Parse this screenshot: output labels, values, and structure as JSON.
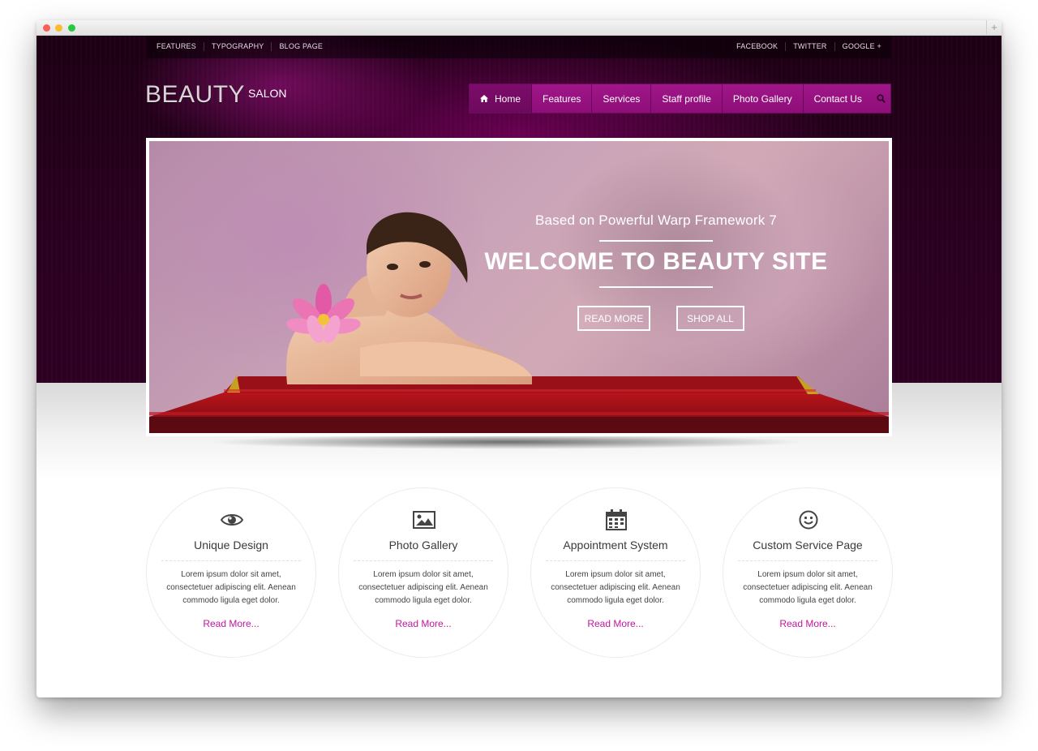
{
  "top_links_left": [
    "FEATURES",
    "TYPOGRAPHY",
    "BLOG PAGE"
  ],
  "top_links_right": [
    "FACEBOOK",
    "TWITTER",
    "GOOGLE +"
  ],
  "logo": {
    "main": "BEAUTY",
    "sub": "SALON"
  },
  "nav": {
    "items": [
      "Home",
      "Features",
      "Services",
      "Staff profile",
      "Photo Gallery",
      "Contact Us"
    ],
    "active": "Home",
    "home_icon": "home-icon",
    "search_icon": "search-icon"
  },
  "hero": {
    "subtitle": "Based on Powerful Warp Framework 7",
    "title": "WELCOME TO BEAUTY SITE",
    "read_more": "READ MORE",
    "shop_all": "SHOP ALL"
  },
  "features": [
    {
      "icon": "eye-icon",
      "title": "Unique Design",
      "text": "Lorem ipsum dolor sit amet, consectetuer adipiscing elit. Aenean commodo ligula eget dolor.",
      "link": "Read More..."
    },
    {
      "icon": "image-icon",
      "title": "Photo Gallery",
      "text": "Lorem ipsum dolor sit amet, consectetuer adipiscing elit. Aenean commodo ligula eget dolor.",
      "link": "Read More..."
    },
    {
      "icon": "calendar-icon",
      "title": "Appointment System",
      "text": "Lorem ipsum dolor sit amet, consectetuer adipiscing elit. Aenean commodo ligula eget dolor.",
      "link": "Read More..."
    },
    {
      "icon": "smiley-icon",
      "title": "Custom Service Page",
      "text": "Lorem ipsum dolor sit amet, consectetuer adipiscing elit. Aenean commodo ligula eget dolor.",
      "link": "Read More..."
    }
  ],
  "colors": {
    "accent": "#c0179d",
    "nav": "#9a1484",
    "dark": "#2a0020"
  }
}
